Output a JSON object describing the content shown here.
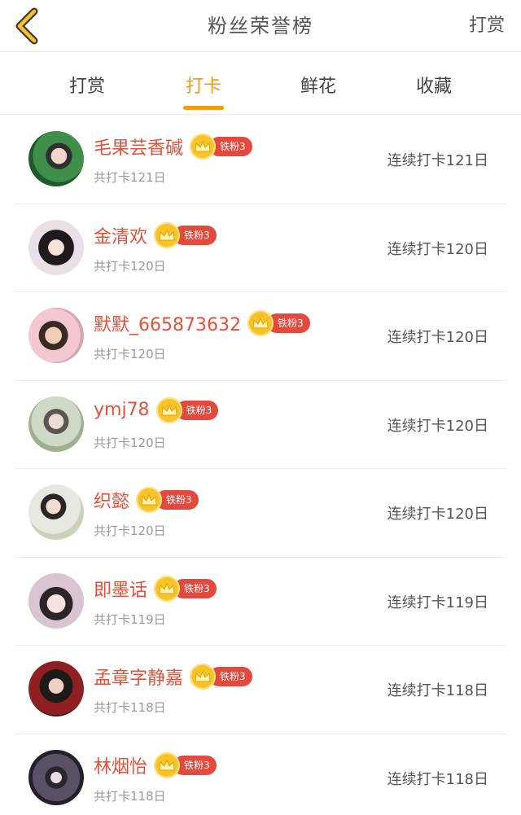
{
  "header": {
    "title": "粉丝荣誉榜",
    "right_action": "打赏"
  },
  "tabs": [
    {
      "label": "打赏",
      "active": false
    },
    {
      "label": "打卡",
      "active": true
    },
    {
      "label": "鲜花",
      "active": false
    },
    {
      "label": "收藏",
      "active": false
    }
  ],
  "colors": {
    "accent": "#f29a16",
    "name": "#e0533a",
    "badge_pill": "#e4493d",
    "badge_crown": "#f7c325"
  },
  "rows": [
    {
      "name": "毛果芸香碱",
      "badge": "铁粉3",
      "total": "共打卡121日",
      "streak": "连续打卡121日"
    },
    {
      "name": "金清欢",
      "badge": "铁粉3",
      "total": "共打卡120日",
      "streak": "连续打卡120日"
    },
    {
      "name": "默默_665873632",
      "badge": "铁粉3",
      "total": "共打卡120日",
      "streak": "连续打卡120日"
    },
    {
      "name": "ymj78",
      "badge": "铁粉3",
      "total": "共打卡120日",
      "streak": "连续打卡120日"
    },
    {
      "name": "织懿",
      "badge": "铁粉3",
      "total": "共打卡120日",
      "streak": "连续打卡120日"
    },
    {
      "name": "即墨话",
      "badge": "铁粉3",
      "total": "共打卡119日",
      "streak": "连续打卡119日"
    },
    {
      "name": "孟章字静嘉",
      "badge": "铁粉3",
      "total": "共打卡118日",
      "streak": "连续打卡118日"
    },
    {
      "name": "林烟怡",
      "badge": "铁粉3",
      "total": "共打卡118日",
      "streak": "连续打卡118日"
    }
  ]
}
